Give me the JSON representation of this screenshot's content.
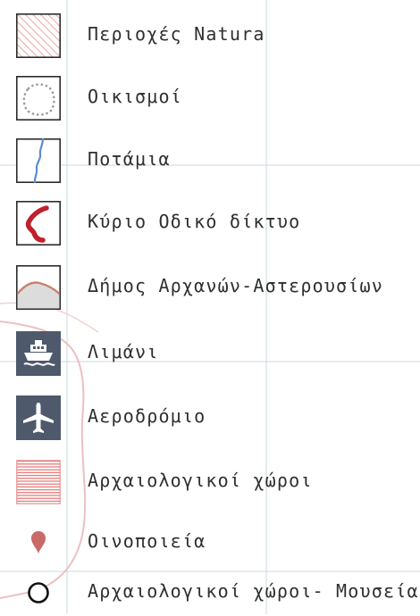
{
  "legend": {
    "items": [
      {
        "label": "Περιοχές Natura",
        "icon": "natura-hatch-icon"
      },
      {
        "label": "Οικισμοί",
        "icon": "settlement-dotted-icon"
      },
      {
        "label": "Ποτάμια",
        "icon": "river-icon"
      },
      {
        "label": "Κύριο Οδικό δίκτυο",
        "icon": "main-road-icon"
      },
      {
        "label": "Δήμος Αρχανών-Αστερουσίων",
        "icon": "municipality-area-icon"
      },
      {
        "label": "Λιμάνι",
        "icon": "ship-icon"
      },
      {
        "label": "Αεροδρόμιο",
        "icon": "airplane-icon"
      },
      {
        "label": "Αρχαιολογικοί χώροι",
        "icon": "archaeological-hatch-icon"
      },
      {
        "label": "Οινοποιεία",
        "icon": "map-pin-icon"
      },
      {
        "label": "Αρχαιολογικοί χώροι- Μουσεία",
        "icon": "circle-icon"
      }
    ]
  },
  "colors": {
    "natura": "#e8908e",
    "road": "#c0202a",
    "river": "#5b8ccf",
    "municipality_fill": "#dcdcdc",
    "municipality_border": "#c9826f",
    "pictogram_bg": "#4e5a6b",
    "pin": "#c86a68",
    "grid": "#c9d9df"
  }
}
